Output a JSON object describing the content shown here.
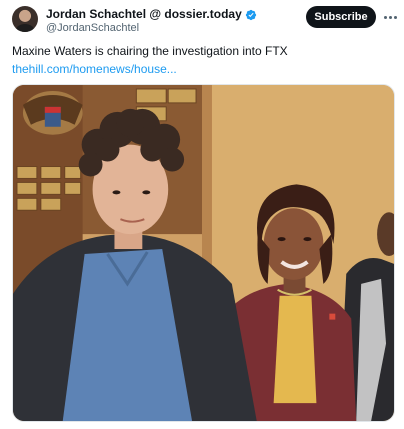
{
  "author": {
    "display_name": "Jordan Schachtel @ dossier.today",
    "handle": "@JordanSchachtel",
    "avatar_icon": "profile-avatar",
    "verified_icon": "verified-badge-icon"
  },
  "actions": {
    "subscribe_label": "Subscribe",
    "more_icon": "more-options-icon"
  },
  "tweet": {
    "text": "Maxine Waters is chairing the investigation into FTX",
    "link_text": "thehill.com/homenews/house..."
  },
  "colors": {
    "link": "#1d9bf0",
    "verified": "#1d9bf0",
    "button_bg": "#0f1419"
  }
}
